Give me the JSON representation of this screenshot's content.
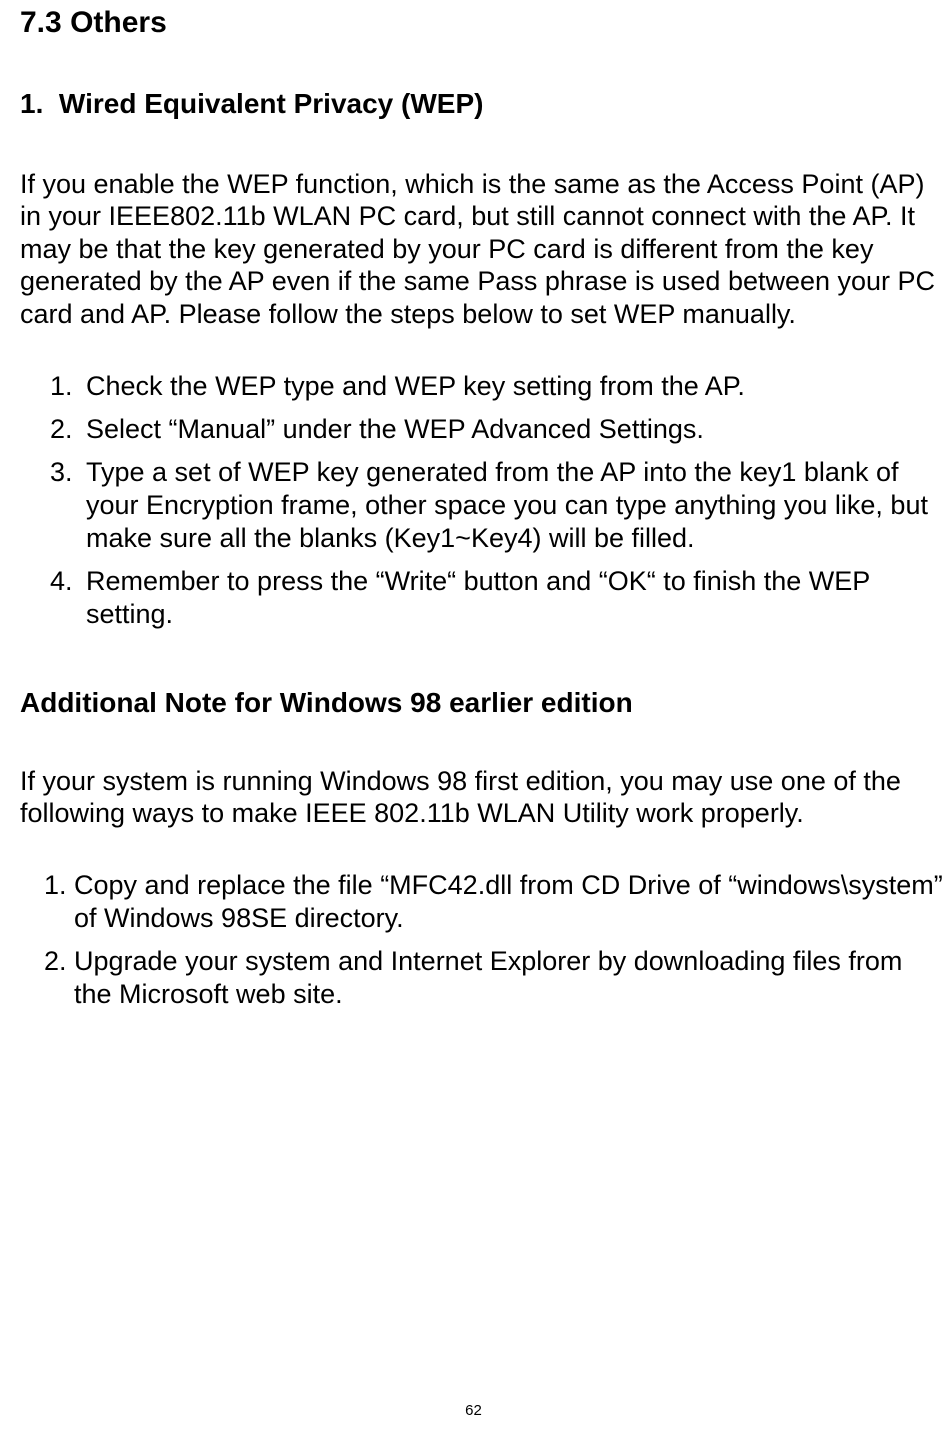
{
  "section": {
    "number": "7.3",
    "title": "Others"
  },
  "sub1": {
    "number": "1.",
    "title": "Wired Equivalent Privacy (WEP)",
    "intro": "If you enable the WEP function, which is the same as the Access Point (AP) in your IEEE802.11b WLAN PC card, but still cannot connect with the AP. It may be that the key generated by your PC card is different from the key generated by the AP even if the same Pass phrase is used between your PC card and AP. Please follow the steps below to set WEP manually.",
    "steps": [
      "Check the WEP type and WEP key setting from the AP.",
      "Select “Manual” under the WEP Advanced Settings.",
      "Type a set of WEP key generated from the AP into the key1 blank of your Encryption frame, other space you can type anything you like, but make sure all the blanks (Key1~Key4) will be filled.",
      "Remember to press the “Write“ button and “OK“ to finish the WEP setting."
    ]
  },
  "sub2": {
    "title": "Additional Note for Windows 98 earlier edition",
    "intro": "If your system is running Windows 98 first edition, you may use one of the following ways to make IEEE 802.11b WLAN Utility work properly.",
    "steps": [
      "Copy and replace the file “MFC42.dll from CD Drive of “windows\\system” of Windows 98SE directory.",
      "Upgrade your system and Internet Explorer by downloading files from the Microsoft web site."
    ]
  },
  "page_number": "62"
}
